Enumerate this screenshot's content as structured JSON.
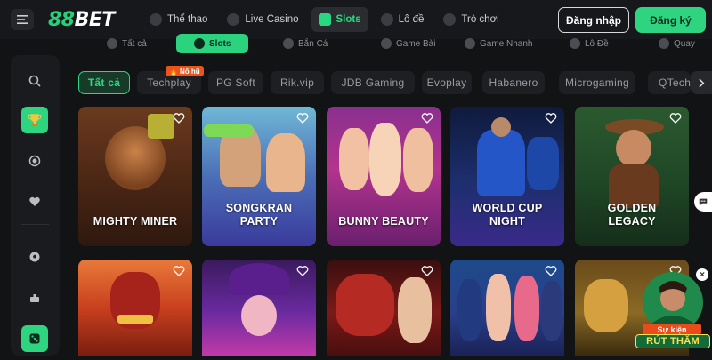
{
  "header": {
    "brand_number": "88",
    "brand_text": "BET",
    "nav": [
      {
        "label": "Thể thao",
        "icon": "soccer-ball-icon",
        "active": false
      },
      {
        "label": "Live Casino",
        "icon": "casino-chip-icon",
        "active": false
      },
      {
        "label": "Slots",
        "icon": "slot-machine-icon",
        "active": true
      },
      {
        "label": "Lô đề",
        "icon": "lottery-icon",
        "active": false
      },
      {
        "label": "Trò chơi",
        "icon": "gamepad-icon",
        "active": false
      }
    ],
    "login_label": "Đăng nhập",
    "register_label": "Đăng ký"
  },
  "category_strip": [
    {
      "label": "Tất cả",
      "active": false
    },
    {
      "label": "Slots",
      "active": true
    },
    {
      "label": "Bắn Cá",
      "active": false
    },
    {
      "label": "Game Bài",
      "active": false
    },
    {
      "label": "Game Nhanh",
      "active": false
    },
    {
      "label": "Lô Đề",
      "active": false
    },
    {
      "label": "Quay",
      "active": false
    }
  ],
  "sidebar": {
    "icons": [
      "search-icon",
      "trophy-icon",
      "target-icon",
      "heart-icon",
      "soccer-icon",
      "casino-icon",
      "dice-icon"
    ]
  },
  "providers": {
    "items": [
      {
        "label": "Tất cả",
        "active": true
      },
      {
        "label": "Techplay",
        "active": false
      },
      {
        "label": "PG Soft",
        "active": false
      },
      {
        "label": "Rik.vip",
        "active": false
      },
      {
        "label": "JDB Gaming",
        "active": false
      },
      {
        "label": "Evoplay",
        "active": false
      },
      {
        "label": "Habanero",
        "active": false
      },
      {
        "label": "Microgaming",
        "active": false
      },
      {
        "label": "QTech",
        "active": false
      }
    ],
    "hot_badge": "Nổ hũ"
  },
  "games": {
    "row1": [
      {
        "title": "MIGHTY MINER",
        "title_l2": ""
      },
      {
        "title": "SONGKRAN",
        "title_l2": "PARTY"
      },
      {
        "title": "BUNNY BEAUTY",
        "title_l2": ""
      },
      {
        "title": "WORLD CUP",
        "title_l2": "NIGHT"
      },
      {
        "title": "GOLDEN",
        "title_l2": "LEGACY"
      }
    ]
  },
  "promo": {
    "line1": "Sự kiện",
    "line2": "RÚT THĂM"
  },
  "colors": {
    "accent": "#2ed47f",
    "background": "#121315",
    "hot": "#e9541b"
  }
}
